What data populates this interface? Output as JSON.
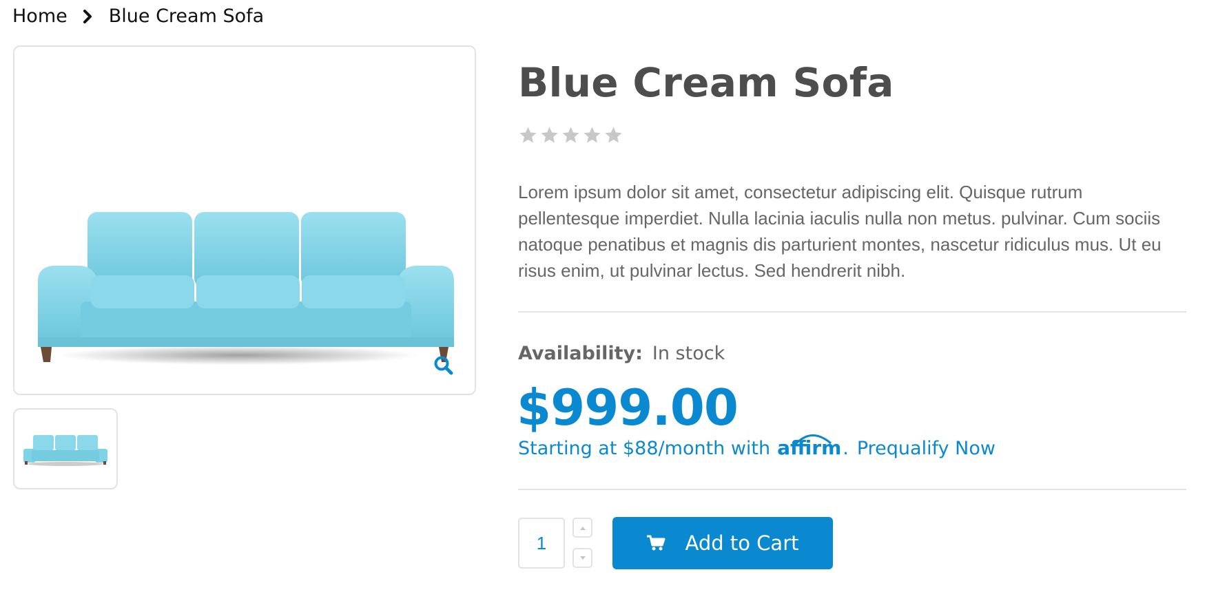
{
  "breadcrumb": {
    "home": "Home",
    "current": "Blue Cream Sofa"
  },
  "product": {
    "title": "Blue Cream Sofa",
    "rating": {
      "stars_filled": 0,
      "stars_total": 5
    },
    "description": "Lorem ipsum dolor sit amet, consectetur adipiscing elit. Quisque rutrum pellentesque imperdiet. Nulla lacinia iaculis nulla non metus. pulvinar. Cum sociis natoque penatibus et magnis dis parturient montes, nascetur ridiculus mus. Ut eu risus enim, ut pulvinar lectus. Sed hendrerit nibh.",
    "availability_label": "Availability:",
    "availability_value": "In stock",
    "price": "$999.00",
    "financing_text": "Starting at $88/month with",
    "affirm_logo_text": "affirm",
    "financing_link": "Prequalify Now",
    "quantity": "1"
  },
  "actions": {
    "add_to_cart": "Add to Cart"
  },
  "icons": {
    "breadcrumb_separator": "chevron-right-icon",
    "zoom": "search-zoom-icon",
    "stepper_up": "caret-up-icon",
    "stepper_down": "caret-down-icon",
    "cart": "cart-icon",
    "star": "star-icon"
  },
  "colors": {
    "accent": "#0a89d1",
    "sofa": "#7fd3e6",
    "star_empty": "#c8c8c8",
    "text": "#4d4d4d"
  }
}
